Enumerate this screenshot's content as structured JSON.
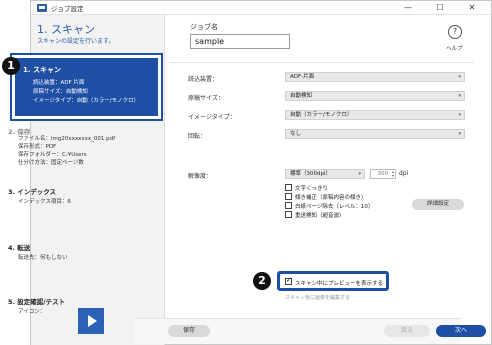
{
  "window": {
    "title": "ジョブ設定",
    "min_glyph": "—",
    "max_glyph": "☐",
    "close_glyph": "✕"
  },
  "sidebar": {
    "heading": "1. スキャン",
    "subheading": "スキャンの設定を行います。",
    "step1": {
      "title": "1. スキャン",
      "lines": [
        "読込装置：ADF 片面",
        "原稿サイズ：自動検知",
        "イメージタイプ：自動（カラー/モノクロ）"
      ]
    },
    "step2": {
      "title": "2. 保存",
      "lines": [
        "ファイル名：img20xxxxxxx_001.pdf",
        "保存形式：PDF",
        "保存フォルダー：C:¥Users",
        "仕分け方法：固定ページ数"
      ]
    },
    "step3": {
      "title": "3. インデックス",
      "lines": [
        "インデックス項目：6"
      ]
    },
    "step4": {
      "title": "4. 転送",
      "lines": [
        "転送先：何もしない"
      ]
    },
    "step5": {
      "title": "5. 設定確認/テスト",
      "lines": [
        "アイコン："
      ]
    }
  },
  "callouts": {
    "one": "1",
    "two": "2"
  },
  "job": {
    "label": "ジョブ名",
    "value": "sample"
  },
  "help": {
    "glyph": "?",
    "label": "ヘルプ"
  },
  "settings": [
    {
      "label": "読込装置：",
      "value": "ADF-片面"
    },
    {
      "label": "原稿サイズ：",
      "value": "自動検知"
    },
    {
      "label": "イメージタイプ：",
      "value": "自動（カラー/モノクロ）"
    },
    {
      "label": "回転：",
      "value": "なし"
    },
    {
      "label": "解像度：",
      "value": "標準（300dpi）"
    }
  ],
  "resolution": {
    "value": "300",
    "unit": "dpi"
  },
  "checkboxes": [
    {
      "label": "文字くっきり",
      "checked": false
    },
    {
      "label": "傾き補正（原稿内容の傾き）",
      "checked": false
    },
    {
      "label": "白紙ページ除去（レベル：10）",
      "checked": false
    },
    {
      "label": "重送検知（超音波）",
      "checked": false
    }
  ],
  "detail_button": "詳細設定",
  "preview": {
    "label": "スキャン中にプレビューを表示する",
    "checked": true,
    "faded_below": "スキャン後に画像を編集する"
  },
  "footer": {
    "save": "保存",
    "back": "戻る",
    "next": "次へ"
  },
  "colors": {
    "accent": "#1f4fa4",
    "sidebar_bg": "#f2f2f2",
    "heading": "#2a5ca8"
  },
  "icons": {
    "app": "scanner-app-icon",
    "help": "question-circle-icon",
    "job_thumbnail": "play-icon"
  }
}
